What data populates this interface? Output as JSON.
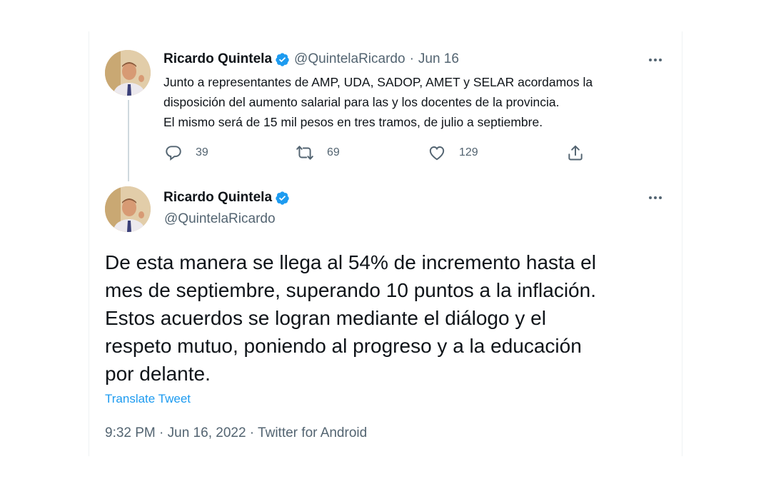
{
  "tweet1": {
    "name": "Ricardo Quintela",
    "handle": "@QuintelaRicardo",
    "separator": "·",
    "date": "Jun 16",
    "text": "Junto a representantes de AMP, UDA, SADOP, AMET y SELAR acordamos la\ndisposición del aumento salarial para las y los docentes de la provincia.\nEl mismo será de 15 mil pesos en tres tramos, de julio a septiembre.",
    "replies": "39",
    "retweets": "69",
    "likes": "129"
  },
  "tweet2": {
    "name": "Ricardo Quintela",
    "handle": "@QuintelaRicardo",
    "text": "De esta manera se llega al 54% de incremento hasta el\nmes de septiembre, superando 10 puntos a la inflación.\nEstos acuerdos se logran mediante el diálogo y el\nrespeto mutuo, poniendo al progreso y a la educación\npor delante.",
    "translate_label": "Translate Tweet",
    "meta": "9:32 PM · Jun 16, 2022 · Twitter for Android"
  },
  "icons": {
    "verified": "verified-badge-icon",
    "more": "more-dots-icon",
    "reply": "reply-icon",
    "retweet": "retweet-icon",
    "like": "heart-icon",
    "share": "share-icon"
  },
  "colors": {
    "accent": "#1d9bf0",
    "secondary_text": "#536471",
    "primary_text": "#0f1419"
  }
}
